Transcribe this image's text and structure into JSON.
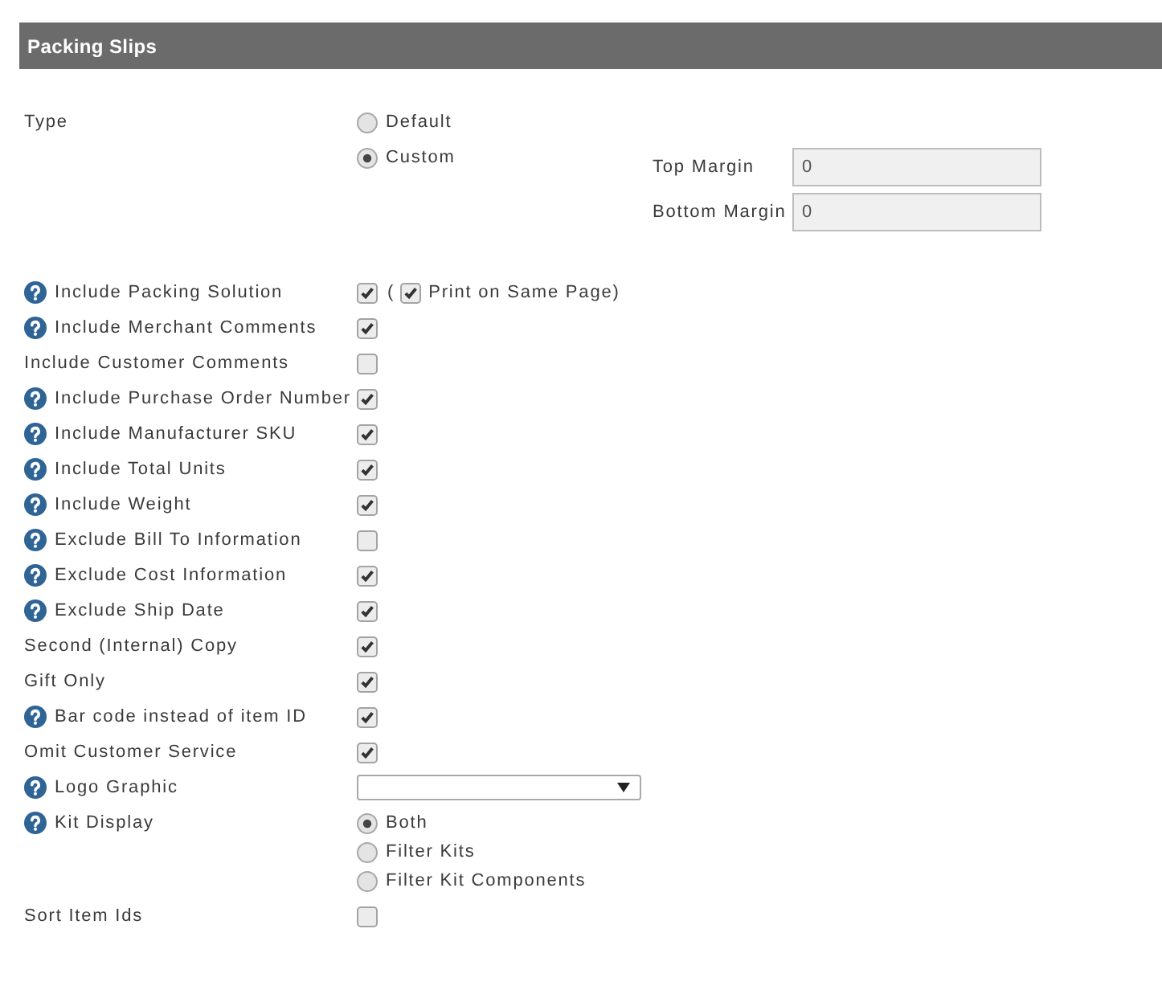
{
  "header": {
    "title": "Packing Slips"
  },
  "type_setting": {
    "label": "Type",
    "options": [
      {
        "label": "Default",
        "selected": false
      },
      {
        "label": "Custom",
        "selected": true
      }
    ],
    "margins": [
      {
        "label": "Top Margin",
        "value": "0"
      },
      {
        "label": "Bottom Margin",
        "value": "0"
      }
    ]
  },
  "settings": [
    {
      "kind": "checkbox",
      "label": "Include Packing Solution",
      "help": true,
      "checked": true,
      "sub_option": {
        "prefix": "(",
        "label": "Print on Same Page)",
        "checked": true
      }
    },
    {
      "kind": "checkbox",
      "label": "Include Merchant Comments",
      "help": true,
      "checked": true
    },
    {
      "kind": "checkbox",
      "label": "Include Customer Comments",
      "help": false,
      "checked": false
    },
    {
      "kind": "checkbox",
      "label": "Include Purchase Order Number",
      "help": true,
      "checked": true
    },
    {
      "kind": "checkbox",
      "label": "Include Manufacturer SKU",
      "help": true,
      "checked": true
    },
    {
      "kind": "checkbox",
      "label": "Include Total Units",
      "help": true,
      "checked": true
    },
    {
      "kind": "checkbox",
      "label": "Include Weight",
      "help": true,
      "checked": true
    },
    {
      "kind": "checkbox",
      "label": "Exclude Bill To Information",
      "help": true,
      "checked": false
    },
    {
      "kind": "checkbox",
      "label": "Exclude Cost Information",
      "help": true,
      "checked": true
    },
    {
      "kind": "checkbox",
      "label": "Exclude Ship Date",
      "help": true,
      "checked": true
    },
    {
      "kind": "checkbox",
      "label": "Second (Internal) Copy",
      "help": false,
      "checked": true
    },
    {
      "kind": "checkbox",
      "label": "Gift Only",
      "help": false,
      "checked": true
    },
    {
      "kind": "checkbox",
      "label": "Bar code instead of item ID",
      "help": true,
      "checked": true
    },
    {
      "kind": "checkbox",
      "label": "Omit Customer Service",
      "help": false,
      "checked": true
    },
    {
      "kind": "select",
      "label": "Logo Graphic",
      "help": true
    },
    {
      "kind": "radio",
      "label": "Kit Display",
      "help": true,
      "options": [
        {
          "label": "Both",
          "selected": true
        },
        {
          "label": "Filter Kits",
          "selected": false
        },
        {
          "label": "Filter Kit Components",
          "selected": false
        }
      ]
    },
    {
      "kind": "checkbox",
      "label": "Sort Item Ids",
      "help": false,
      "checked": false
    }
  ]
}
